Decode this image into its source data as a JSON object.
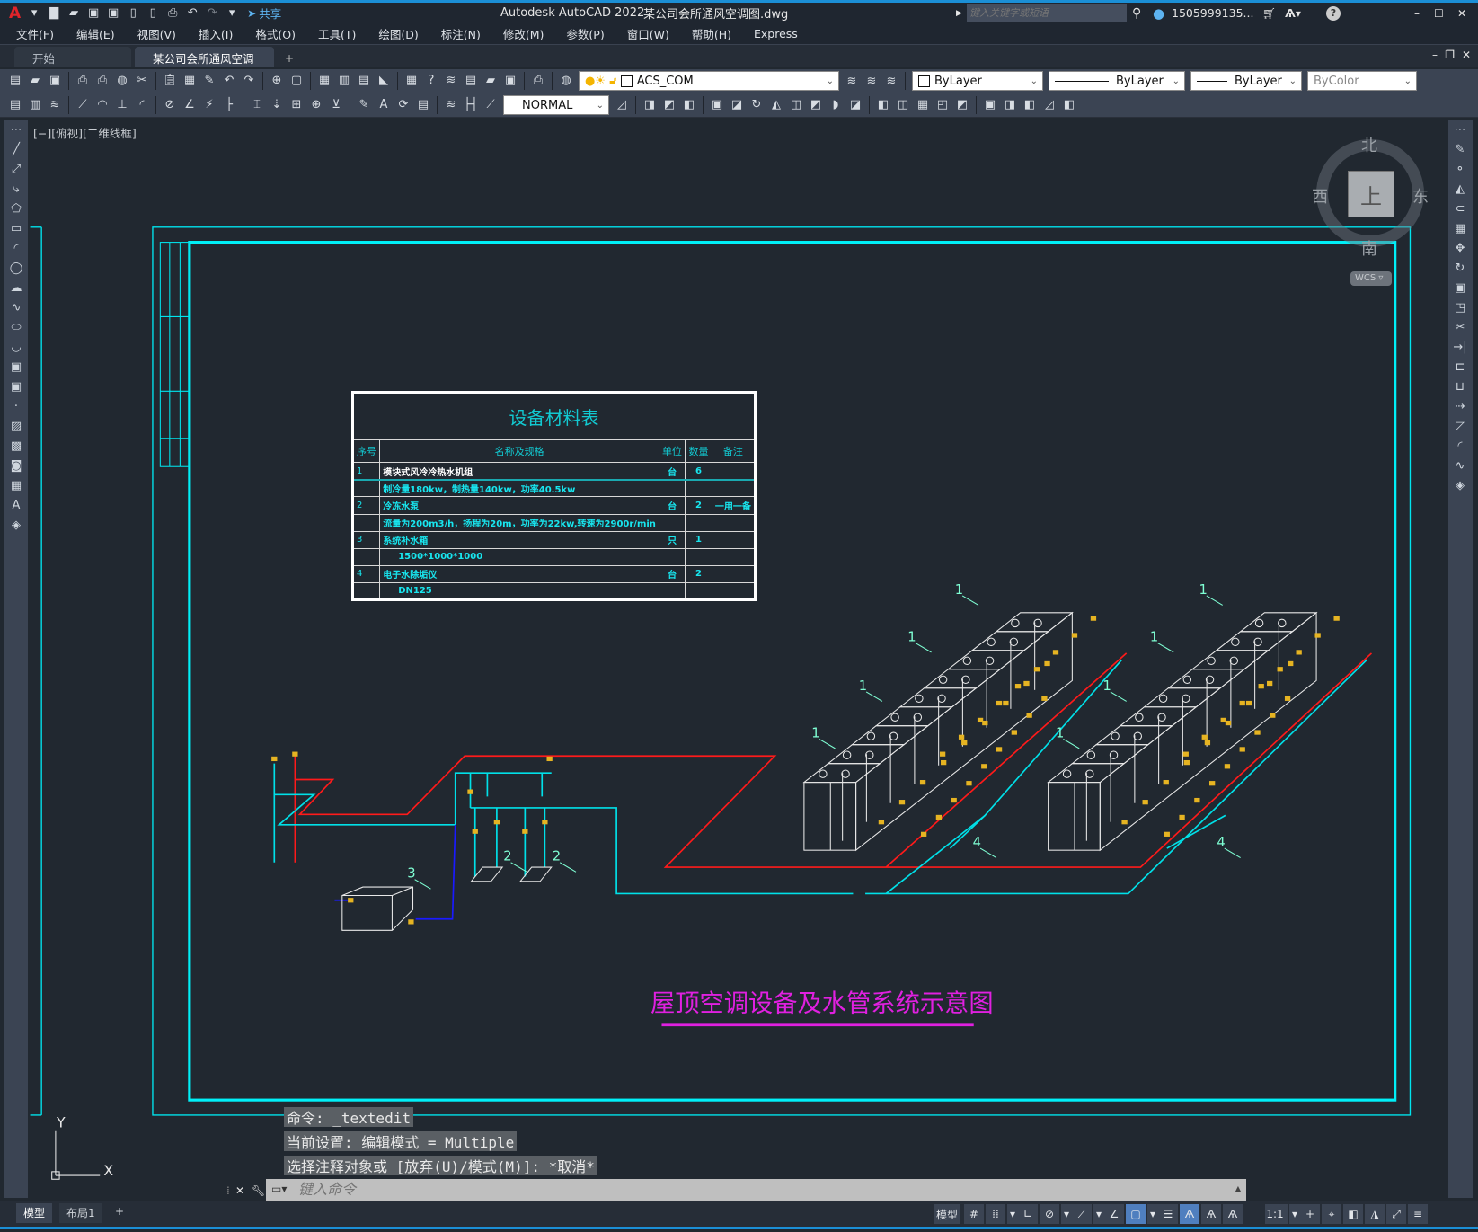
{
  "titlebar": {
    "app_title": "Autodesk AutoCAD 2022",
    "doc_title": "某公司会所通风空调图.dwg",
    "share": "共享",
    "search_placeholder": "键入关键字或短语",
    "user": "1505999135...",
    "icons": [
      "autocad-logo",
      "new-icon",
      "open-icon",
      "save-icon",
      "saveas-icon",
      "plot-icon",
      "undo-icon",
      "redo-icon",
      "share-icon",
      "search-icon",
      "user-icon",
      "cart-icon",
      "autodesk-app-icon",
      "help-icon",
      "minimize-icon",
      "maximize-icon",
      "close-icon"
    ]
  },
  "menu": [
    "文件(F)",
    "编辑(E)",
    "视图(V)",
    "插入(I)",
    "格式(O)",
    "工具(T)",
    "绘图(D)",
    "标注(N)",
    "修改(M)",
    "参数(P)",
    "窗口(W)",
    "帮助(H)",
    "Express"
  ],
  "tabs": [
    {
      "label": "开始"
    },
    {
      "label": "某公司会所通风空调图*",
      "active": true
    }
  ],
  "toolbar": {
    "layer": "ACS_COM",
    "color": "ByLayer",
    "linetype": "ByLayer",
    "lineweight": "ByLayer",
    "plotstyle": "ByColor",
    "dimstyle": "NORMAL"
  },
  "viewport": {
    "label": "[−][俯视][二维线框]"
  },
  "viewcube": {
    "north": "北",
    "south": "南",
    "east": "东",
    "west": "西",
    "top": "上",
    "wcs": "WCS"
  },
  "ucs": {
    "x": "X",
    "y": "Y"
  },
  "material_table": {
    "title": "设备材料表",
    "headers": [
      "序号",
      "名称及规格",
      "单位",
      "数量",
      "备注"
    ],
    "rows": [
      [
        "1",
        "模块式风冷冷热水机组",
        "台",
        "6",
        ""
      ],
      [
        "",
        "制冷量180kw，制热量140kw，功率40.5kw",
        "",
        "",
        ""
      ],
      [
        "2",
        "冷冻水泵",
        "台",
        "2",
        "一用一备"
      ],
      [
        "",
        "流量为200m3/h，扬程为20m，功率为22kw,转速为2900r/min",
        "",
        "",
        ""
      ],
      [
        "3",
        "系统补水箱",
        "只",
        "1",
        ""
      ],
      [
        "",
        "1500*1000*1000",
        "",
        "",
        ""
      ],
      [
        "4",
        "电子水除垢仪",
        "台",
        "2",
        ""
      ],
      [
        "",
        "DN125",
        "",
        "",
        ""
      ]
    ]
  },
  "drawing": {
    "title": "屋顶空调设备及水管系统示意图",
    "callouts": [
      "1",
      "1",
      "1",
      "1",
      "1",
      "1",
      "1",
      "1",
      "2",
      "2",
      "3",
      "4",
      "4"
    ],
    "colors": {
      "frame": "#00e5ee",
      "supply": "#ff1a1a",
      "return": "#00e0e8",
      "makeup": "#1a1aff",
      "valve": "#e6b422",
      "title": "#e020e0",
      "equipment": "#e8e8e8"
    }
  },
  "command": {
    "history": [
      "命令:  _textedit",
      "当前设置: 编辑模式 = Multiple",
      "选择注释对象或 [放弃(U)/模式(M)]: *取消*"
    ],
    "placeholder": "键入命令"
  },
  "layout_tabs": [
    "模型",
    "布局1"
  ],
  "statusbar": {
    "model": "模型",
    "scale": "1:1"
  }
}
